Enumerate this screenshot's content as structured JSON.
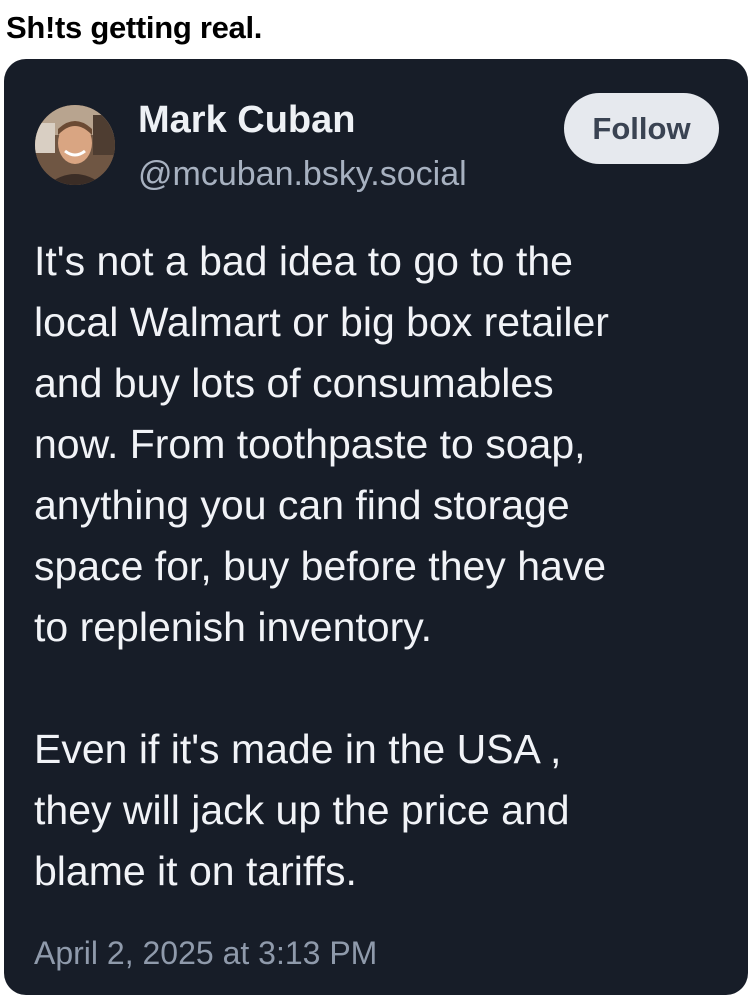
{
  "caption": "Sh!ts getting real.",
  "post": {
    "author": {
      "name": "Mark Cuban",
      "handle": "@mcuban.bsky.social"
    },
    "follow_label": "Follow",
    "paragraph1": [
      "It's not a bad idea to go to the",
      "local Walmart or big box retailer",
      "and buy lots of consumables",
      "now.  From toothpaste to soap,",
      "anything you can find storage",
      "space for, buy before they have",
      "to replenish inventory."
    ],
    "paragraph2": [
      "Even if it's made in the USA ,",
      "they will jack up the price and",
      "blame it on tariffs."
    ],
    "timestamp": "April 2, 2025 at 3:13 PM"
  },
  "colors": {
    "card_background": "#171d28",
    "follow_button": "#e6e9ee",
    "handle_text": "#a7b1c0"
  }
}
